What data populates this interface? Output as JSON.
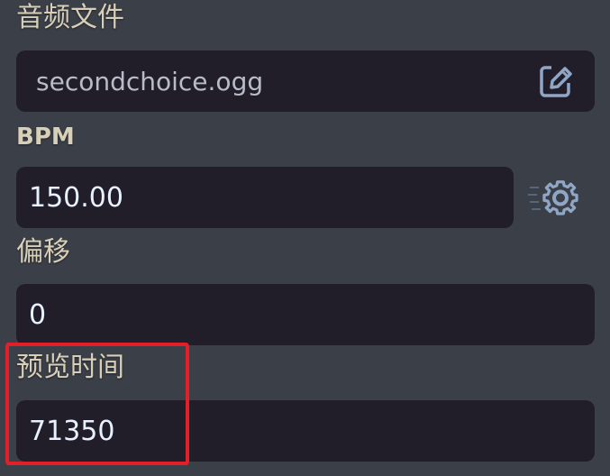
{
  "fields": {
    "audio_file": {
      "label": "音频文件",
      "value": "secondchoice.ogg",
      "action_icon": "edit-icon"
    },
    "bpm": {
      "label": "BPM",
      "value": "150.00",
      "action_icon": "gear-icon"
    },
    "offset": {
      "label": "偏移",
      "value": "0"
    },
    "preview_time": {
      "label": "预览时间",
      "value": "71350"
    }
  },
  "colors": {
    "background": "#3b3f48",
    "field_background": "#211e2a",
    "label_text": "#d8cfb8",
    "value_text": "#e8f1ff",
    "icon_color": "#8fa6c4",
    "highlight": "#e3202a"
  }
}
